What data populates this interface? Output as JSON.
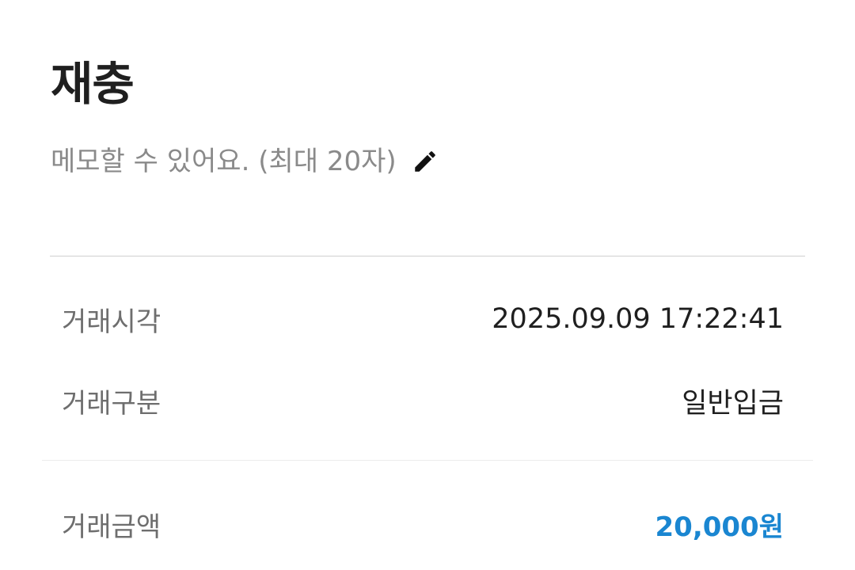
{
  "header": {
    "title": "재충"
  },
  "memo": {
    "placeholder": "메모할 수 있어요. (최대 20자)",
    "edit_icon": "pencil-icon"
  },
  "details": {
    "time_label": "거래시각",
    "time_value": "2025.09.09 17:22:41",
    "type_label": "거래구분",
    "type_value": "일반입금",
    "amount_label": "거래금액",
    "amount_value": "20,000원"
  },
  "colors": {
    "amount": "#1a86d1",
    "title": "#1f1f1f",
    "label": "#6e6e6e",
    "placeholder": "#8a8a8a"
  }
}
